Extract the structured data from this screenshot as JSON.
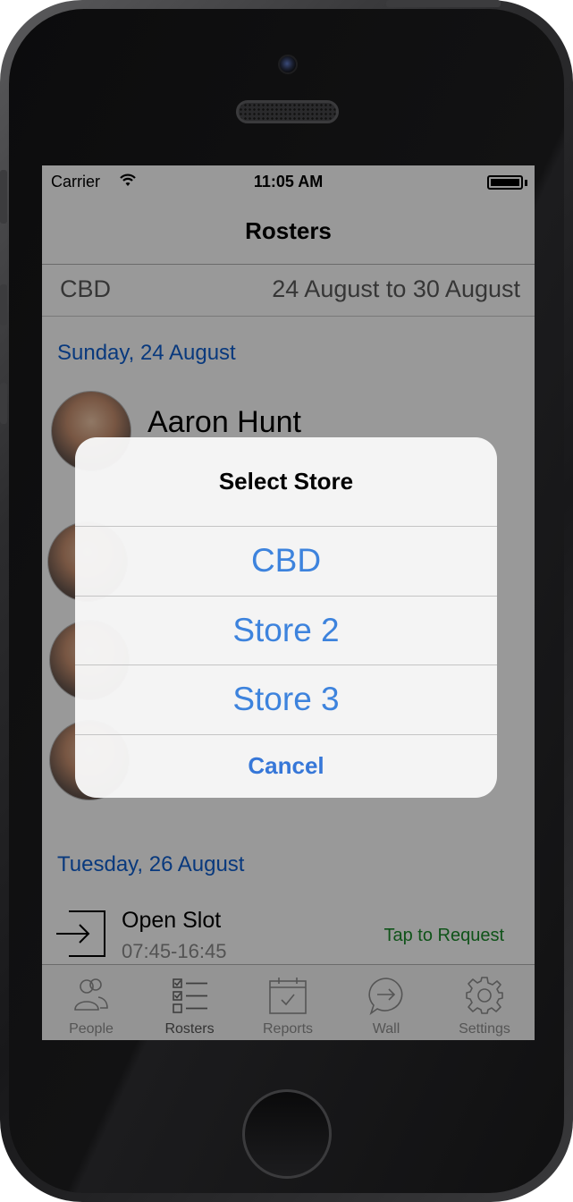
{
  "status_bar": {
    "carrier": "Carrier",
    "time": "11:05 AM",
    "wifi_icon": "wifi-icon",
    "battery_icon": "battery-icon",
    "battery_level": 1.0
  },
  "nav": {
    "title": "Rosters"
  },
  "store_bar": {
    "store": "CBD",
    "date_range": "24 August to 30 August"
  },
  "sections": [
    {
      "header": "Sunday, 24 August"
    },
    {
      "header": "Tuesday, 26 August"
    }
  ],
  "people": [
    {
      "name": "Aaron Hunt"
    }
  ],
  "open_slot": {
    "title": "Open Slot",
    "time": "07:45-16:45",
    "action": "Tap to Request",
    "icon": "login-arrow-icon"
  },
  "tabs": [
    {
      "label": "People",
      "icon": "people-icon",
      "active": false
    },
    {
      "label": "Rosters",
      "icon": "checklist-icon",
      "active": true
    },
    {
      "label": "Reports",
      "icon": "calendar-check-icon",
      "active": false
    },
    {
      "label": "Wall",
      "icon": "chat-arrow-icon",
      "active": false
    },
    {
      "label": "Settings",
      "icon": "gear-icon",
      "active": false
    }
  ],
  "alert": {
    "title": "Select Store",
    "options": [
      "CBD",
      "Store 2",
      "Store 3"
    ],
    "cancel": "Cancel"
  },
  "colors": {
    "link_blue": "#3d83dd",
    "section_blue": "#0f5fd1",
    "action_green": "#1a8a2a",
    "overlay": "rgba(0,0,0,0.40)"
  }
}
